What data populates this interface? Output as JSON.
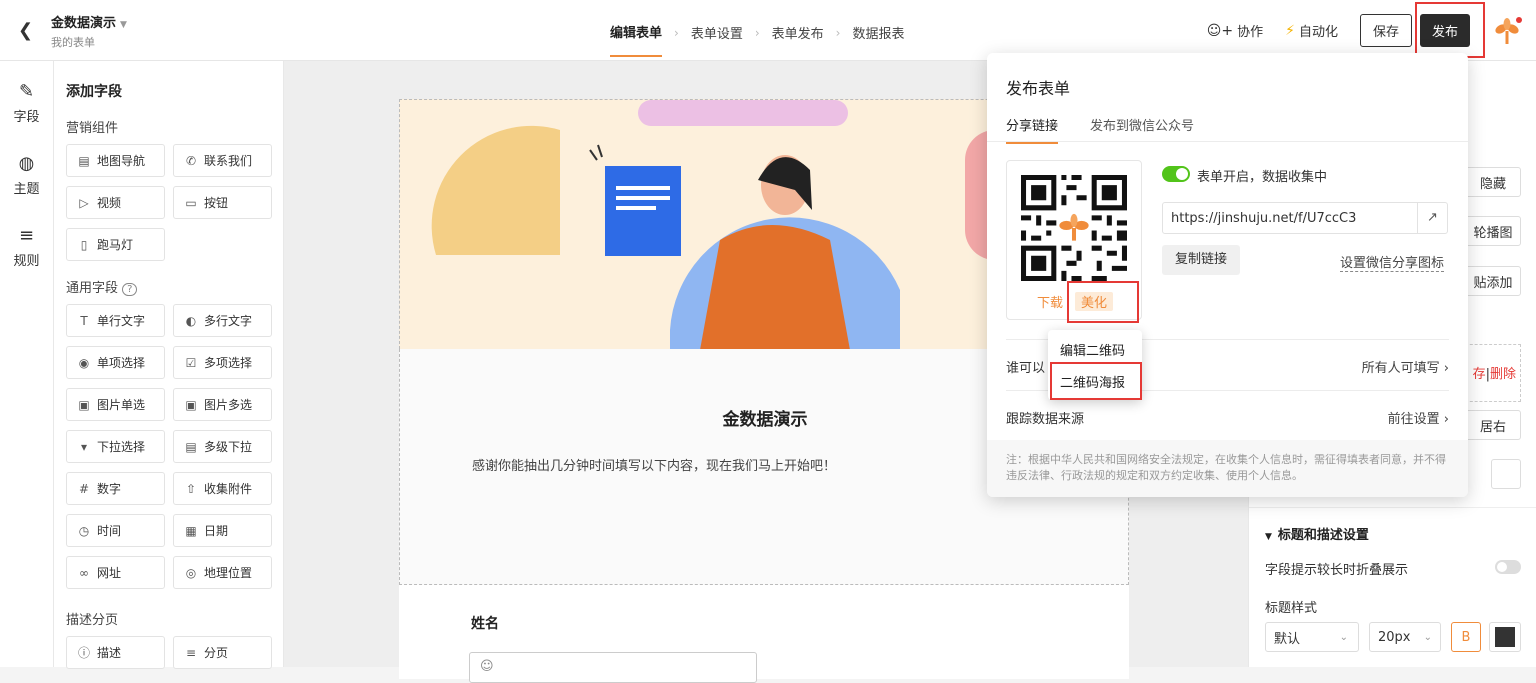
{
  "header": {
    "back_icon": "chevron-left-icon",
    "title": "金数据演示",
    "subtitle": "我的表单",
    "steps": [
      "编辑表单",
      "表单设置",
      "表单发布",
      "数据报表"
    ],
    "collab": "协作",
    "automation": "自动化",
    "save": "保存",
    "publish": "发布"
  },
  "leftnav": {
    "fields": "字段",
    "theme": "主题",
    "rules": "规则"
  },
  "fields": {
    "title": "添加字段",
    "marketing_title": "营销组件",
    "marketing": [
      "地图导航",
      "联系我们",
      "视频",
      "按钮",
      "跑马灯"
    ],
    "common_title": "通用字段",
    "common": [
      "单行文字",
      "多行文字",
      "单项选择",
      "多项选择",
      "图片单选",
      "图片多选",
      "下拉选择",
      "多级下拉",
      "数字",
      "收集附件",
      "时间",
      "日期",
      "网址",
      "地理位置"
    ],
    "desc_title": "描述分页",
    "desc": [
      "描述",
      "分页"
    ]
  },
  "form": {
    "title": "金数据演示",
    "description": "感谢你能抽出几分钟时间填写以下内容，现在我们马上开始吧！",
    "question": "姓名"
  },
  "rightpanel": {
    "hide": "隐藏",
    "carousel": "轮播图",
    "paste_add": "贴添加",
    "delete_hint": "存",
    "delete": "删除",
    "align_right": "居右",
    "title_section": "标题和描述设置",
    "collapse": "字段提示较长时折叠展示",
    "title_style": "标题样式",
    "style_default": "默认",
    "size": "20px",
    "bold": "B"
  },
  "popup": {
    "title": "发布表单",
    "tab_share": "分享链接",
    "tab_wechat": "发布到微信公众号",
    "toggle_text": "表单开启，数据收集中",
    "link": "https://jinshuju.net/f/U7ccC3",
    "copy": "复制链接",
    "wx_icon": "设置微信分享图标",
    "download": "下载",
    "beautify": "美化",
    "who_label": "谁可以",
    "who_value": "所有人可填写",
    "track_label": "跟踪数据来源",
    "track_value": "前往设置",
    "note": "注：根据中华人民共和国网络安全法规定，在收集个人信息时，需征得填表者同意，并不得违反法律、行政法规的规定和双方约定收集、使用个人信息。"
  },
  "dropdown": {
    "edit_qr": "编辑二维码",
    "qr_poster": "二维码海报"
  },
  "colors": {
    "accent": "#f08c3b",
    "highlight": "#e53935",
    "toggle": "#52c41a"
  }
}
